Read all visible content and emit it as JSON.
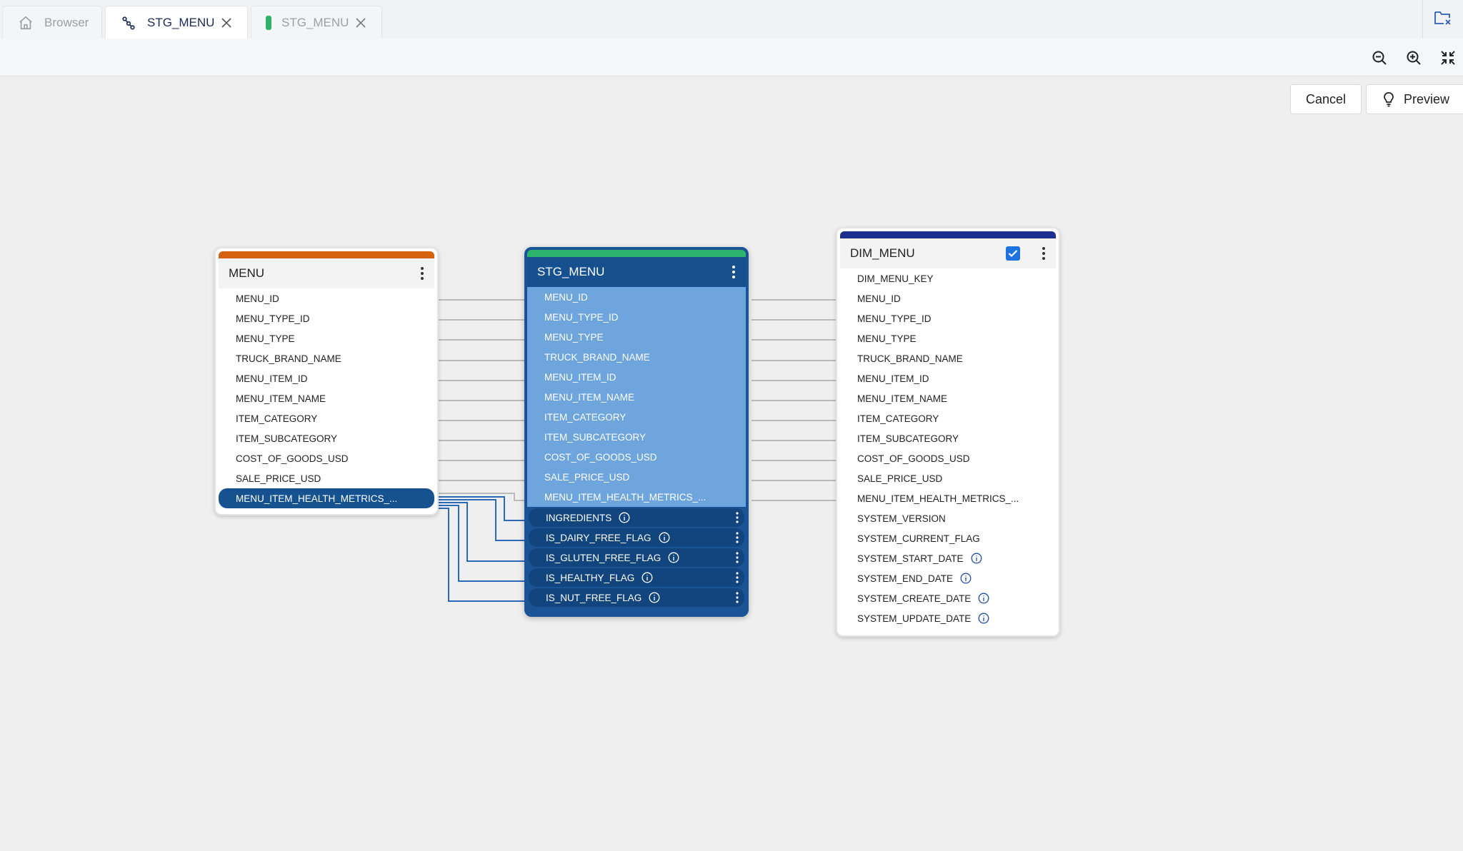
{
  "tabs": [
    {
      "label": "Browser",
      "icon": "home-icon",
      "active": false
    },
    {
      "label": "STG_MENU",
      "icon": "lineage-icon",
      "active": true
    },
    {
      "label": "STG_MENU",
      "icon": "green-marker-icon",
      "active": false
    }
  ],
  "toolbar": {
    "zoom_out": "zoom-out-icon",
    "zoom_in": "zoom-in-icon",
    "fit": "fit-screen-icon"
  },
  "actions": {
    "cancel_label": "Cancel",
    "preview_label": "Preview"
  },
  "colors": {
    "menu_bar": "#d4620f",
    "stg_bar": "#2db36b",
    "dim_bar": "#1f2f8f",
    "stg_body": "#1a5396",
    "stg_rows": "#6ea5dc"
  },
  "nodes": {
    "menu": {
      "title": "MENU",
      "columns": [
        "MENU_ID",
        "MENU_TYPE_ID",
        "MENU_TYPE",
        "TRUCK_BRAND_NAME",
        "MENU_ITEM_ID",
        "MENU_ITEM_NAME",
        "ITEM_CATEGORY",
        "ITEM_SUBCATEGORY",
        "COST_OF_GOODS_USD",
        "SALE_PRICE_USD",
        "MENU_ITEM_HEALTH_METRICS_..."
      ]
    },
    "stg": {
      "title": "STG_MENU",
      "columns": [
        "MENU_ID",
        "MENU_TYPE_ID",
        "MENU_TYPE",
        "TRUCK_BRAND_NAME",
        "MENU_ITEM_ID",
        "MENU_ITEM_NAME",
        "ITEM_CATEGORY",
        "ITEM_SUBCATEGORY",
        "COST_OF_GOODS_USD",
        "SALE_PRICE_USD",
        "MENU_ITEM_HEALTH_METRICS_..."
      ],
      "derived_columns": [
        "INGREDIENTS",
        "IS_DAIRY_FREE_FLAG",
        "IS_GLUTEN_FREE_FLAG",
        "IS_HEALTHY_FLAG",
        "IS_NUT_FREE_FLAG"
      ]
    },
    "dim": {
      "title": "DIM_MENU",
      "checked": true,
      "columns": [
        "DIM_MENU_KEY",
        "MENU_ID",
        "MENU_TYPE_ID",
        "MENU_TYPE",
        "TRUCK_BRAND_NAME",
        "MENU_ITEM_ID",
        "MENU_ITEM_NAME",
        "ITEM_CATEGORY",
        "ITEM_SUBCATEGORY",
        "COST_OF_GOODS_USD",
        "SALE_PRICE_USD",
        "MENU_ITEM_HEALTH_METRICS_...",
        "SYSTEM_VERSION",
        "SYSTEM_CURRENT_FLAG"
      ],
      "info_columns": [
        "SYSTEM_START_DATE",
        "SYSTEM_END_DATE",
        "SYSTEM_CREATE_DATE",
        "SYSTEM_UPDATE_DATE"
      ]
    }
  }
}
